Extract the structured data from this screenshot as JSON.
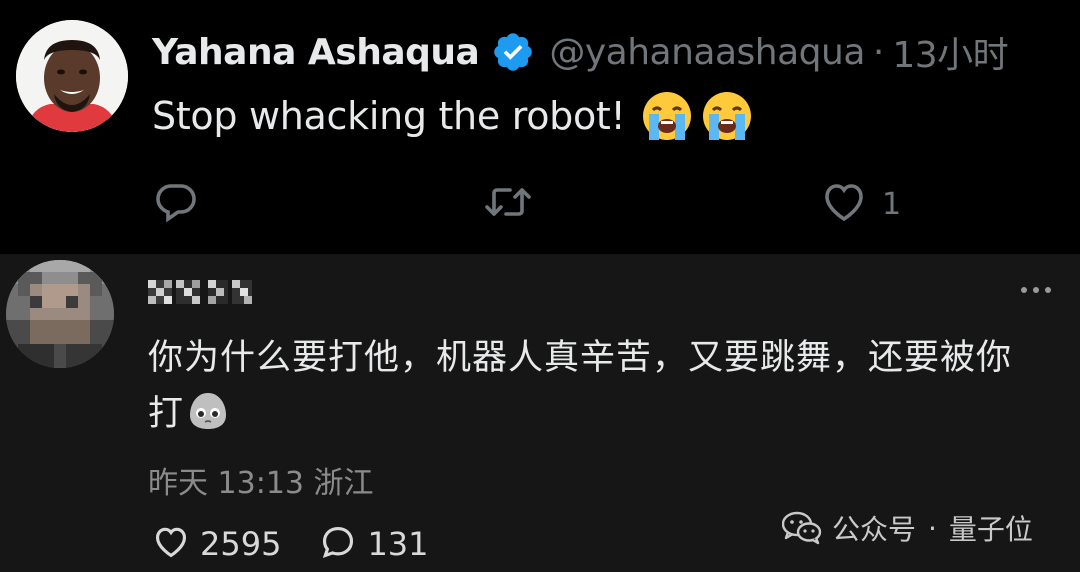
{
  "tweet": {
    "author_name": "Yahana Ashaqua",
    "handle": "@yahanaashaqua",
    "separator": "·",
    "time": "13小时",
    "text": "Stop whacking the robot!",
    "emojis": [
      "loudly-crying-face",
      "loudly-crying-face"
    ],
    "actions": {
      "reply_count": "",
      "retweet_count": "",
      "like_count": "1"
    }
  },
  "reply": {
    "author_name_redacted": true,
    "text_line1": "你为什么要打他，机器人真辛苦，又要跳舞，还要被你",
    "text_line2": "打",
    "emoji": "pleading-face",
    "meta": "昨天 13:13 浙江",
    "like_count": "2595",
    "comment_count": "131"
  },
  "watermark": {
    "brand": "公众号",
    "separator": "·",
    "name": "量子位",
    "icon": "wechat-icon"
  },
  "colors": {
    "background_top": "#000000",
    "background_reply": "#161616",
    "text_primary": "#e7e9ea",
    "text_secondary": "#71767b",
    "verified_blue": "#1d9bf0",
    "avatar_shirt": "#e0393e"
  }
}
